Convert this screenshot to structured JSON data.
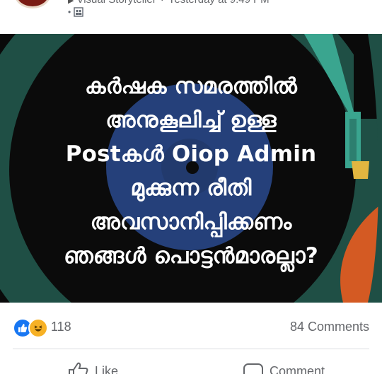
{
  "header": {
    "meta_text": "Visual Storyteller",
    "meta_time": "Yesterday at 9:49 PM",
    "privacy_icon": "group-icon"
  },
  "post_image": {
    "lines": [
      "കർഷക സമരത്തിൽ",
      "അനുകൂലിച്ച് ഉള്ള",
      "Postകൾ Oiop  Admin",
      "മുക്കുന്ന രീതി",
      "അവസാനിപ്പിക്കണം",
      "ഞങ്ങൾ പൊട്ടൻമാരല്ലാ?"
    ],
    "colors": {
      "background": "#0a0a0a",
      "teal": "#1f4f45",
      "blue_disc": "#25407a",
      "orange": "#d45a23",
      "teal_arm": "#3aa58f",
      "text": "#ffffff"
    }
  },
  "reactions": {
    "count": "118",
    "comments": "84 Comments",
    "icons": [
      "like-icon",
      "haha-icon"
    ]
  },
  "actions": {
    "like_label": "Like",
    "comment_label": "Comment"
  }
}
